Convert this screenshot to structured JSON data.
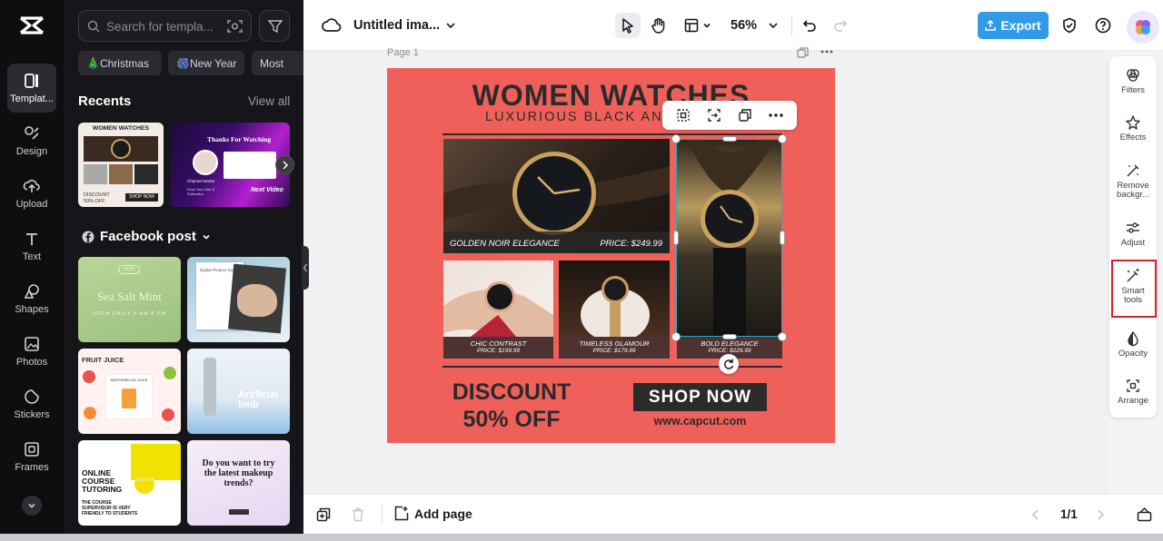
{
  "rail": {
    "items": [
      {
        "label": "Templat...",
        "icon": "template-icon"
      },
      {
        "label": "Design",
        "icon": "design-icon"
      },
      {
        "label": "Upload",
        "icon": "upload-icon"
      },
      {
        "label": "Text",
        "icon": "text-icon"
      },
      {
        "label": "Shapes",
        "icon": "shapes-icon"
      },
      {
        "label": "Photos",
        "icon": "photos-icon"
      },
      {
        "label": "Stickers",
        "icon": "stickers-icon"
      },
      {
        "label": "Frames",
        "icon": "frames-icon"
      }
    ]
  },
  "panel": {
    "search_placeholder": "Search for templa...",
    "chips": [
      "🎄Christmas",
      "🎆New Year",
      "Most"
    ],
    "recents_title": "Recents",
    "view_all": "View all",
    "facebook_title": "Facebook post",
    "recent_templates": [
      {
        "title": "WOMEN WATCHES",
        "discount": "DISCOUNT 50% OFF",
        "shop": "SHOP NOW"
      },
      {
        "title": "Thanks For Watching",
        "channel": "Channel Name",
        "footer": "Next Video",
        "sub": "Drop Your Like & Subscribe"
      }
    ],
    "facebook_templates": [
      {
        "title": "Sea Salt Mint",
        "badge": "NEW",
        "sub": "OPEN DAILY 8 AM-8 PM"
      },
      {
        "title": "Digital Product Guide"
      },
      {
        "title": "FRUIT JUICE",
        "sub": "WATERMELON JUICE"
      },
      {
        "title": "Artificial limb"
      },
      {
        "title": "ONLINE COURSE TUTORING",
        "badge": "15% OFF",
        "sub": "THE COURSE SUPERVISOR IS VERY FRIENDLY TO STUDENTS"
      },
      {
        "title": "Do you want to try the latest makeup trends?"
      }
    ]
  },
  "topbar": {
    "title": "Untitled ima...",
    "zoom": "56%",
    "export_label": "Export"
  },
  "canvas": {
    "page_label": "Page 1"
  },
  "design": {
    "title": "WOMEN WATCHES",
    "subtitle": "LUXURIOUS BLACK AND",
    "product1_name": "GOLDEN NOIR ELEGANCE",
    "product1_price": "PRICE: $249.99",
    "product2_name": "CHIC CONTRAST",
    "product2_price": "PRICE: $199.99",
    "product3_name": "TIMELESS GLAMOUR",
    "product3_price": "PRICE: $179.99",
    "product4_name": "BOLD ELEGANCE",
    "product4_price": "PRICE: $229.99",
    "discount_line1": "DISCOUNT",
    "discount_line2": "50% OFF",
    "shop_now": "SHOP NOW",
    "website": "www.capcut.com",
    "colors": {
      "background": "#f0605a",
      "dark": "#2b2b2b"
    }
  },
  "right_tools": [
    {
      "label": "Filters",
      "icon": "filters-icon"
    },
    {
      "label": "Effects",
      "icon": "effects-icon"
    },
    {
      "label": "Remove backgr...",
      "icon": "remove-bg-icon"
    },
    {
      "label": "Adjust",
      "icon": "adjust-icon"
    },
    {
      "label": "Smart tools",
      "icon": "smart-tools-icon"
    },
    {
      "label": "Opacity",
      "icon": "opacity-icon"
    },
    {
      "label": "Arrange",
      "icon": "arrange-icon"
    }
  ],
  "bottombar": {
    "add_page": "Add page",
    "page_count": "1/1"
  }
}
